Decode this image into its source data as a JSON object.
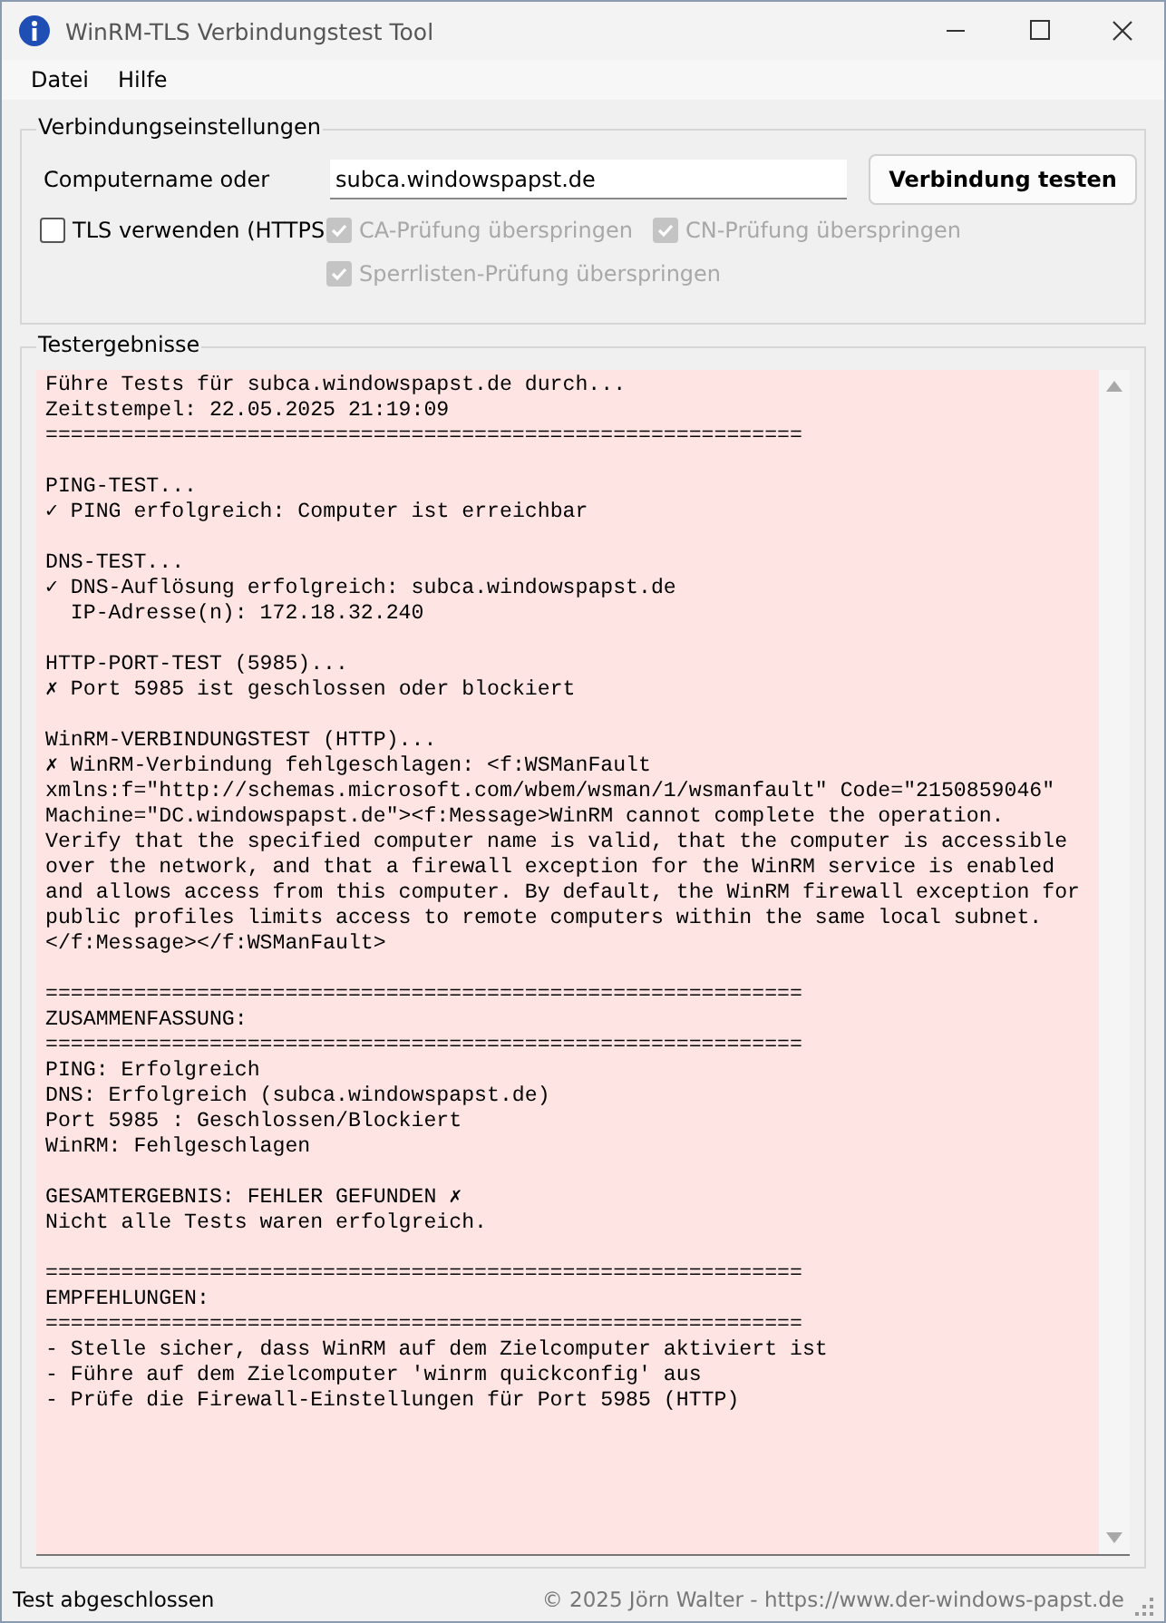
{
  "window": {
    "title": "WinRM-TLS Verbindungstest Tool"
  },
  "menu": [
    "Datei",
    "Hilfe"
  ],
  "settings": {
    "title": "Verbindungseinstellungen",
    "computer_label": "Computername oder",
    "computer_value": "subca.windowspapst.de",
    "test_button": "Verbindung testen",
    "options": [
      {
        "label": "TLS  verwenden (HTTPS",
        "checked": false,
        "disabled": false
      },
      {
        "label": "CA-Prüfung überspringen",
        "checked": true,
        "disabled": true
      },
      {
        "label": "CN-Prüfung überspringen",
        "checked": true,
        "disabled": true
      },
      {
        "label": "Sperrlisten-Prüfung überspringen",
        "checked": true,
        "disabled": true
      }
    ]
  },
  "results": {
    "title": "Testergebnisse",
    "blocks": [
      [
        "Führe Tests für subca.windowspapst.de durch...",
        "Zeitstempel: 22.05.2025 21:19:09",
        "============================================================"
      ],
      [
        "PING-TEST...",
        "✓ PING erfolgreich: Computer ist erreichbar"
      ],
      [
        "DNS-TEST...",
        "✓ DNS-Auflösung erfolgreich: subca.windowspapst.de",
        "  IP-Adresse(n): 172.18.32.240"
      ],
      [
        "HTTP-PORT-TEST (5985)...",
        "✗ Port 5985 ist geschlossen oder blockiert"
      ],
      [
        "WinRM-VERBINDUNGSTEST (HTTP)...",
        "✗ WinRM-Verbindung fehlgeschlagen: <f:WSManFault",
        "xmlns:f=\"http://schemas.microsoft.com/wbem/wsman/1/wsmanfault\" Code=\"2150859046\"",
        "Machine=\"DC.windowspapst.de\"><f:Message>WinRM cannot complete the operation.",
        "Verify that the specified computer name is valid, that the computer is accessible",
        "over the network, and that a firewall exception for the WinRM service is enabled",
        "and allows access from this computer. By default, the WinRM firewall exception for",
        "public profiles limits access to remote computers within the same local subnet.",
        "</f:Message></f:WSManFault>"
      ],
      [
        "============================================================",
        "ZUSAMMENFASSUNG:",
        "============================================================",
        "PING: Erfolgreich",
        "DNS: Erfolgreich (subca.windowspapst.de)",
        "Port 5985 : Geschlossen/Blockiert",
        "WinRM: Fehlgeschlagen"
      ],
      [
        "GESAMTERGEBNIS: FEHLER GEFUNDEN ✗",
        "Nicht alle Tests waren erfolgreich."
      ],
      [
        "============================================================",
        "EMPFEHLUNGEN:",
        "============================================================",
        "- Stelle sicher, dass WinRM auf dem Zielcomputer aktiviert ist",
        "- Führe auf dem Zielcomputer 'winrm quickconfig' aus",
        "- Prüfe die Firewall-Einstellungen für Port 5985 (HTTP)"
      ]
    ]
  },
  "status_bar": {
    "message": "Test abgeschlossen",
    "copyright": "© 2025 Jörn Walter - https://www.der-windows-papst.de"
  }
}
